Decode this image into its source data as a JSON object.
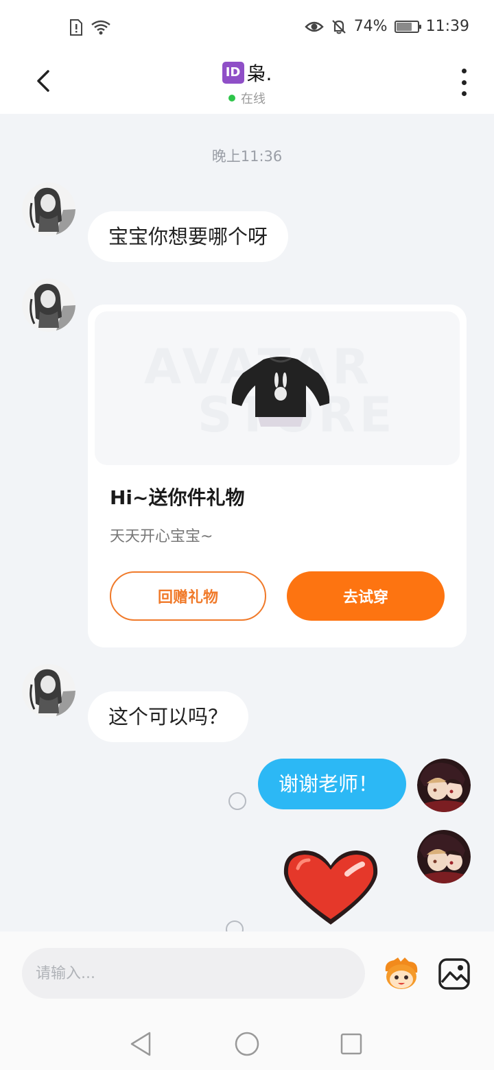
{
  "status_bar": {
    "battery": "74%",
    "battery_level": 0.74,
    "time": "11:39",
    "icons": [
      "sim-alert-icon",
      "wifi-icon",
      "eye-icon",
      "bell-off-icon",
      "battery-icon"
    ]
  },
  "header": {
    "badge": "ID",
    "name": "枭.",
    "status": "在线",
    "status_color": "#2ec54a"
  },
  "chat": {
    "timestamp": "晚上11:36",
    "messages": [
      {
        "from": "them",
        "text": "宝宝你想要哪个呀"
      },
      {
        "from": "them",
        "type": "gift_card"
      },
      {
        "from": "them",
        "text": "这个可以吗？"
      },
      {
        "from": "me",
        "text": "谢谢老师！"
      },
      {
        "from": "me",
        "type": "sticker",
        "sticker": "heart-sticker"
      }
    ]
  },
  "gift_card": {
    "watermark_line1": "AVATAR",
    "watermark_line2": "STORE",
    "title": "Hi~送你件礼物",
    "subtitle": "天天开心宝宝~",
    "btn_return": "回赠礼物",
    "btn_try": "去试穿"
  },
  "input": {
    "placeholder": "请输入..."
  },
  "colors": {
    "accent_orange": "#fd7411",
    "my_bubble": "#2cb8f5",
    "background": "#f2f4f7"
  }
}
